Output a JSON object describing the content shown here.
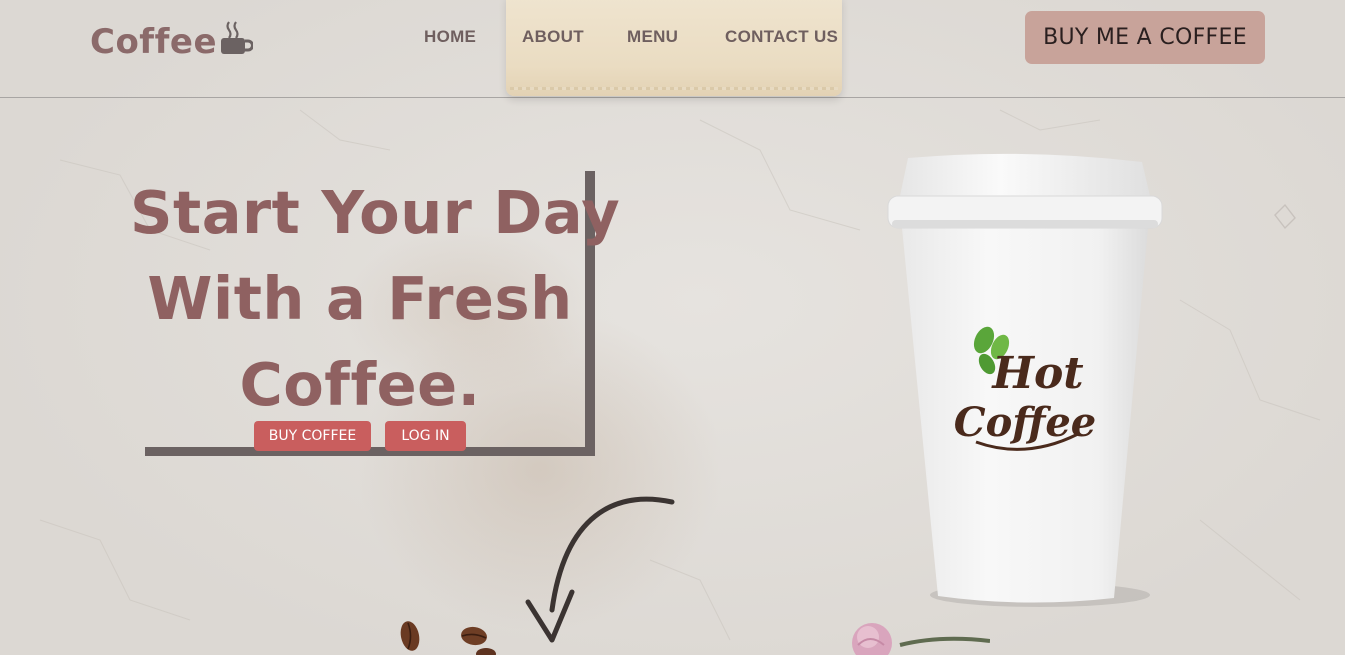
{
  "brand": {
    "name": "Coffee",
    "icon": "coffee-cup-icon"
  },
  "nav": {
    "items": [
      {
        "label": "HOME"
      },
      {
        "label": "ABOUT"
      },
      {
        "label": "MENU"
      },
      {
        "label": "CONTACT US"
      }
    ]
  },
  "header": {
    "cta_label": "BUY ME A COFFEE"
  },
  "hero": {
    "title_lines": [
      "Start Your Day",
      "With a Fresh",
      "Coffee."
    ],
    "buy_label": "BUY COFFEE",
    "login_label": "LOG IN"
  },
  "product": {
    "cup_logo_line1": "Hot",
    "cup_logo_line2": "Coffee"
  },
  "colors": {
    "brand": "#8b6a6a",
    "title": "#8f6161",
    "nav": "#6f5f5f",
    "cta_bg": "#c8a39a",
    "button_bg": "#c95e5e",
    "frame": "#6b6262",
    "background": "#dedad6"
  }
}
